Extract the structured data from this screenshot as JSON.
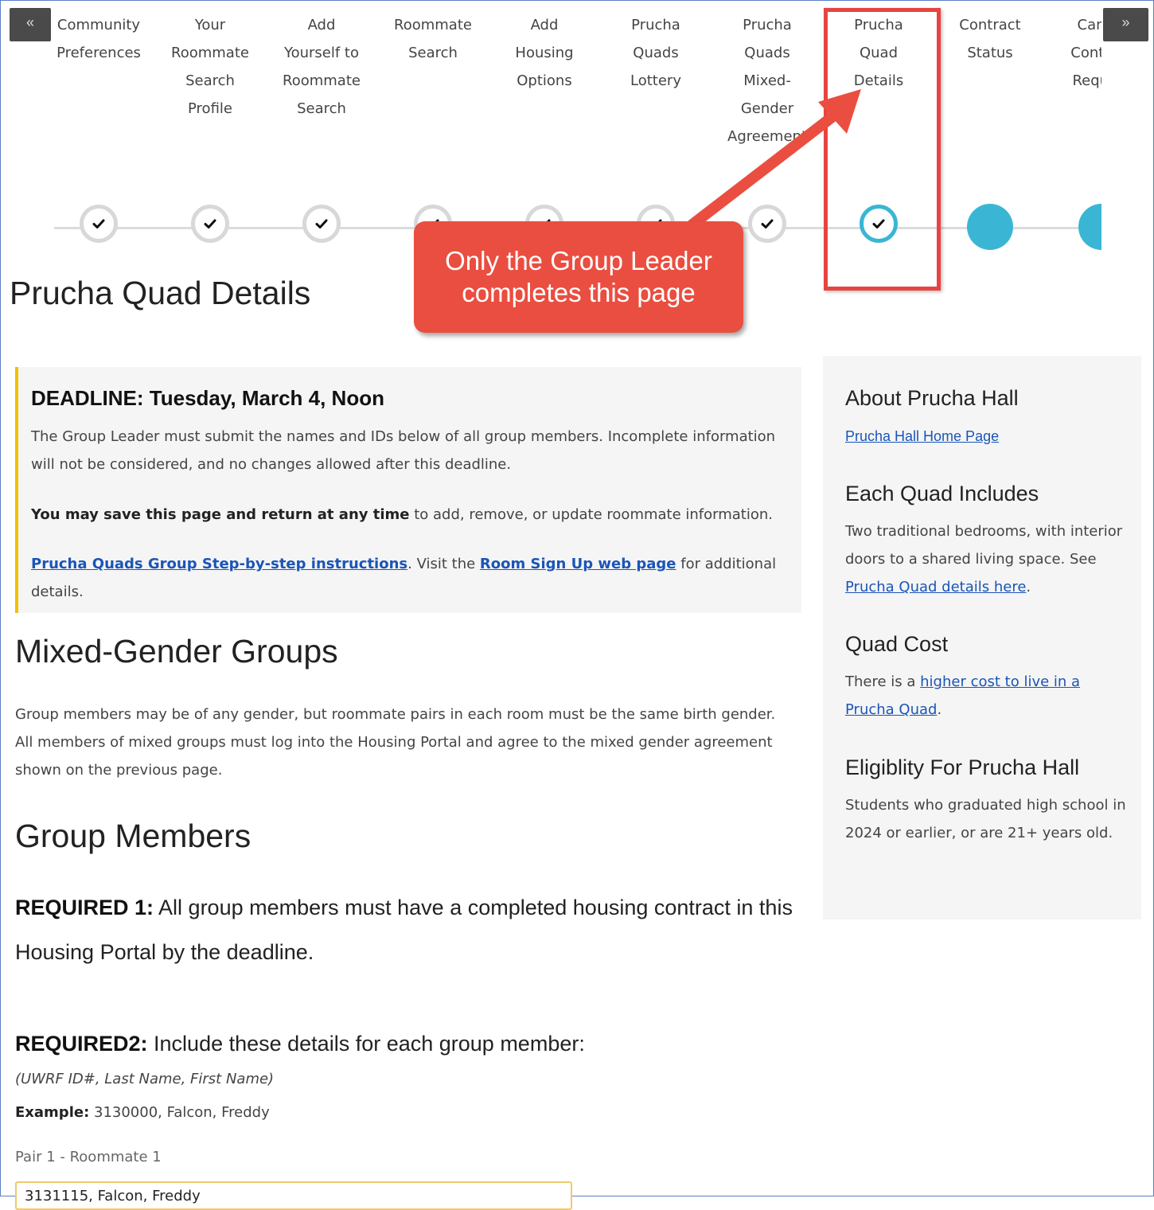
{
  "nav": {
    "prev_glyph": "«",
    "next_glyph": "»",
    "steps": [
      {
        "label": "Community\nPreferences",
        "status": "complete"
      },
      {
        "label": "Your\nRoommate\nSearch\nProfile",
        "status": "complete"
      },
      {
        "label": "Add\nYourself to\nRoommate\nSearch",
        "status": "complete"
      },
      {
        "label": "Roommate\nSearch",
        "status": "complete"
      },
      {
        "label": "Add\nHousing\nOptions",
        "status": "complete"
      },
      {
        "label": "Prucha\nQuads\nLottery",
        "status": "complete"
      },
      {
        "label": "Prucha\nQuads\nMixed-\nGender\nAgreement",
        "status": "complete"
      },
      {
        "label": "Prucha\nQuad\nDetails",
        "status": "current"
      },
      {
        "label": "Contract\nStatus",
        "status": "pending"
      },
      {
        "label": "Cancel\nContract\nRequest",
        "status": "pending"
      }
    ],
    "check_icon": "check-icon"
  },
  "page_title": "Prucha Quad Details",
  "deadline": {
    "title": "DEADLINE: Tuesday, March 4, Noon",
    "p1": "The Group Leader must submit the names and IDs below of all group members. Incomplete information will not be considered, and no changes allowed after this deadline.",
    "p2_bold": "You may save this page and return at any time",
    "p2_rest": " to add, remove, or update roommate information.",
    "p3_link1": "Prucha Quads Group Step-by-step instructions",
    "p3_mid": ". Visit the ",
    "p3_link2": "Room Sign Up web page",
    "p3_end": " for additional details.",
    "accent_color": "#f0c000"
  },
  "mixed": {
    "heading": "Mixed-Gender Groups",
    "text": "Group members may be of any gender, but roommate pairs in each room must be the same birth gender. All members of mixed groups must log into the Housing Portal and agree to the mixed gender agreement shown on the previous page."
  },
  "members": {
    "heading": "Group Members",
    "req1_bold": "REQUIRED 1:",
    "req1_text": " All group members must have a completed housing contract in this Housing Portal by the deadline.",
    "req2_bold": "REQUIRED2:",
    "req2_text": " Include these details for each group member:",
    "format_note": "(UWRF ID#, Last Name, First Name)",
    "example_bold": "Example:",
    "example_text": " 3130000, Falcon, Freddy",
    "field_label": "Pair 1 - Roommate 1",
    "field_value": "3131115, Falcon, Freddy"
  },
  "sidebar": {
    "about_heading": "About Prucha Hall",
    "about_link": "Prucha Hall Home Page",
    "includes_heading": "Each Quad Includes",
    "includes_text": "Two traditional bedrooms, with interior doors to a shared living space. See ",
    "includes_link": "Prucha Quad details here",
    "includes_end": ".",
    "cost_heading": "Quad Cost",
    "cost_text": "There is a ",
    "cost_link": "higher cost to live in a Prucha Quad",
    "cost_end": ".",
    "elig_heading": "Eligiblity For Prucha Hall",
    "elig_text": "Students who graduated high school in 2024 or earlier, or are 21+ years old."
  },
  "annotation": {
    "callout_text": "Only the Group Leader completes this page",
    "color": "#ea4e40"
  },
  "colors": {
    "accent_teal": "#3ab6d4",
    "link_blue": "#1a55b8"
  }
}
